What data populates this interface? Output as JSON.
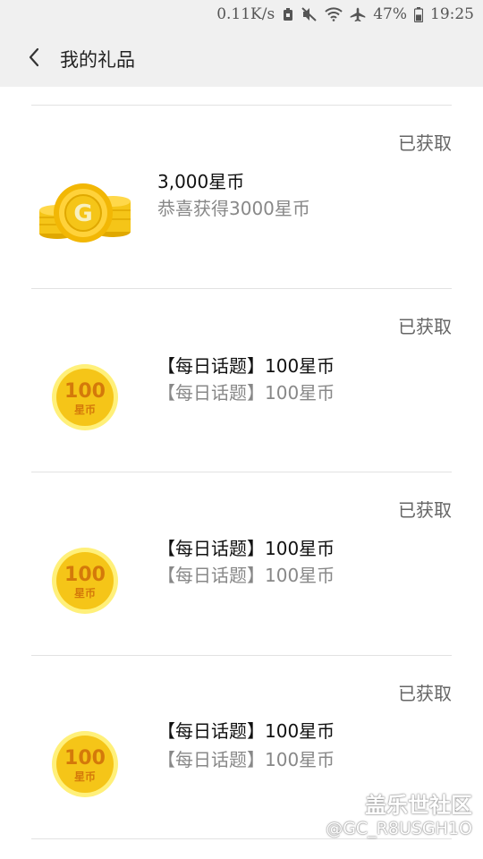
{
  "status_bar": {
    "speed": "0.11K/s",
    "battery": "47%",
    "time": "19:25",
    "icons": [
      "notification-icon",
      "mute-icon",
      "wifi-icon",
      "airplane-icon",
      "battery-icon"
    ]
  },
  "header": {
    "back_icon": "chevron-left-icon",
    "title": "我的礼品"
  },
  "gifts": [
    {
      "title": "3,000星币",
      "description": "恭喜获得3000星币",
      "status": "已获取",
      "icon": "gold-coins-icon"
    },
    {
      "title": "【每日话题】100星币",
      "description": "【每日话题】100星币",
      "status": "已获取",
      "icon": "coin-100-icon",
      "coin_value": "100",
      "coin_label": "星币"
    },
    {
      "title": "【每日话题】100星币",
      "description": "【每日话题】100星币",
      "status": "已获取",
      "icon": "coin-100-icon",
      "coin_value": "100",
      "coin_label": "星币"
    },
    {
      "title": "【每日话题】100星币",
      "description": "【每日话题】100星币",
      "status": "已获取",
      "icon": "coin-100-icon",
      "coin_value": "100",
      "coin_label": "星币"
    }
  ],
  "watermark": {
    "site": "盖乐世社区",
    "user": "@GC_R8USGH1O"
  },
  "colors": {
    "coin_gold": "#f5c518",
    "coin_dark": "#e0a800",
    "coin_text": "#d4790a",
    "header_bg": "#f0f0f0",
    "divider": "#e2e2e2"
  }
}
